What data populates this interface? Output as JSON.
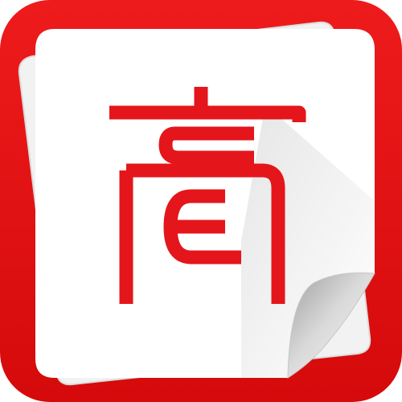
{
  "app_icon": {
    "logo_glyph": "高",
    "icon_name": "paper-note-logo-icon",
    "colors": {
      "frame_red": "#e60f10",
      "frame_red_dark": "#c20506",
      "paper": "#ffffff",
      "paper_back": "#f1f1f1",
      "glyph_red": "#e4161b",
      "curl_shade": "#b9b9b9"
    }
  }
}
